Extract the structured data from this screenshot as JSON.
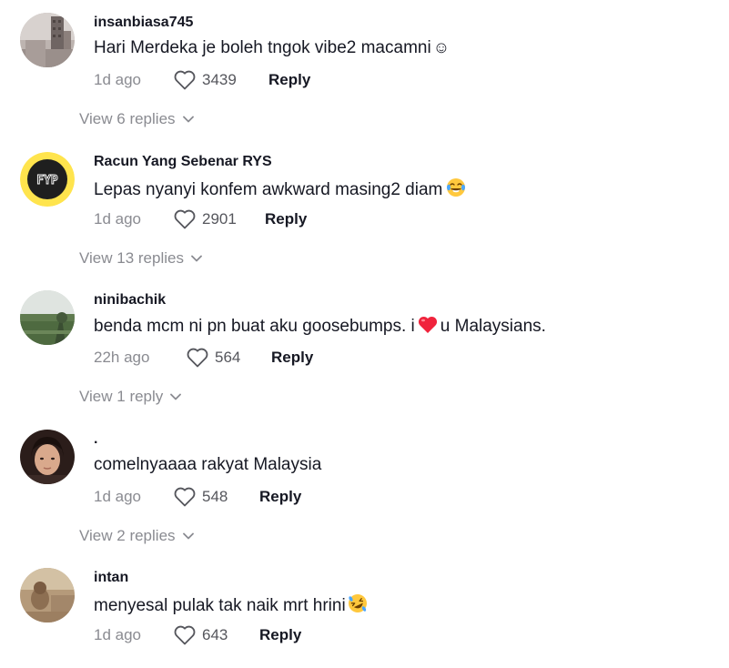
{
  "comments": [
    {
      "username": "insanbiasa745",
      "text": "Hari Merdeka je boleh tngok vibe2 macamni",
      "text_suffix": "☺",
      "time": "1d ago",
      "likes": "3439",
      "reply_label": "Reply",
      "view_replies": "View 6 replies",
      "avatar_icon": "avatar-building-photo"
    },
    {
      "username": "Racun Yang Sebenar RYS",
      "text": "Lepas nyanyi konfem awkward masing2 diam",
      "emoji": "laughing-tears-emoji",
      "time": "1d ago",
      "likes": "2901",
      "reply_label": "Reply",
      "view_replies": "View 13 replies",
      "avatar_icon": "avatar-fyp-logo",
      "avatar_text": "FYP"
    },
    {
      "username": "ninibachik",
      "text_before": "benda mcm ni pn buat aku goosebumps. i",
      "text_after": "u Malaysians.",
      "emoji": "red-heart-emoji",
      "time": "22h ago",
      "likes": "564",
      "reply_label": "Reply",
      "view_replies": "View 1 reply",
      "avatar_icon": "avatar-landscape-photo"
    },
    {
      "username": ".",
      "text": "comelnyaaaa rakyat Malaysia",
      "time": "1d ago",
      "likes": "548",
      "reply_label": "Reply",
      "view_replies": "View 2 replies",
      "avatar_icon": "avatar-person-photo"
    },
    {
      "username": "intan",
      "text": "menyesal pulak tak naik mrt hrini",
      "emoji": "rolling-laughing-emoji",
      "time": "1d ago",
      "likes": "643",
      "reply_label": "Reply",
      "avatar_icon": "avatar-sepia-photo"
    }
  ],
  "colors": {
    "primary_text": "#161823",
    "secondary_text": "#8a8b91",
    "fyp_badge_bg": "#ffe44d"
  }
}
